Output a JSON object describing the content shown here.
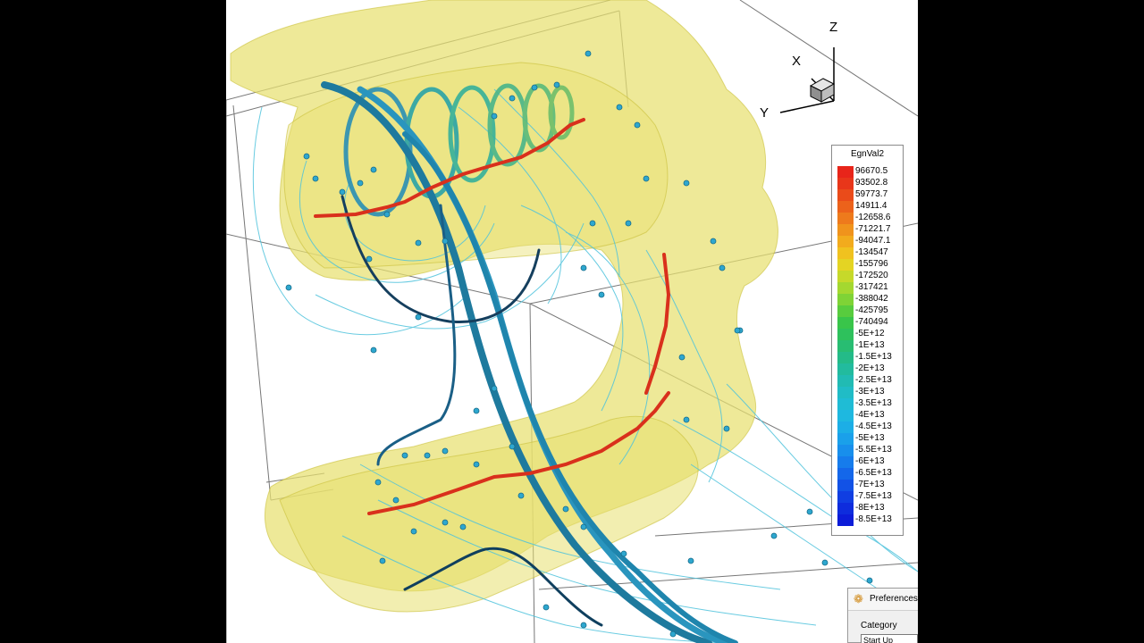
{
  "axes": {
    "x_label": "X",
    "y_label": "Y",
    "z_label": "Z"
  },
  "legend": {
    "title": "EgnVal2",
    "entries": [
      {
        "label": "96670.5",
        "color": "#e8251a"
      },
      {
        "label": "93502.8",
        "color": "#e8361a"
      },
      {
        "label": "59773.7",
        "color": "#ea4b1a"
      },
      {
        "label": "14911.4",
        "color": "#ec621b"
      },
      {
        "label": "-12658.6",
        "color": "#ee7a1c"
      },
      {
        "label": "-71221.7",
        "color": "#f0931c"
      },
      {
        "label": "-94047.1",
        "color": "#f2ab1d"
      },
      {
        "label": "-134547",
        "color": "#f0c21f"
      },
      {
        "label": "-155796",
        "color": "#e4d423"
      },
      {
        "label": "-172520",
        "color": "#c6d92a"
      },
      {
        "label": "-317421",
        "color": "#a4d830"
      },
      {
        "label": "-388042",
        "color": "#7fd336"
      },
      {
        "label": "-425795",
        "color": "#58cc3e"
      },
      {
        "label": "-740494",
        "color": "#39c54a"
      },
      {
        "label": "-5E+12",
        "color": "#2ec15c"
      },
      {
        "label": "-1E+13",
        "color": "#28bd72"
      },
      {
        "label": "-1.5E+13",
        "color": "#24bb88"
      },
      {
        "label": "-2E+13",
        "color": "#22bb9e"
      },
      {
        "label": "-2.5E+13",
        "color": "#21bbb3"
      },
      {
        "label": "-3E+13",
        "color": "#20bcc6"
      },
      {
        "label": "-3.5E+13",
        "color": "#1fbcd5"
      },
      {
        "label": "-4E+13",
        "color": "#1eb8e0"
      },
      {
        "label": "-4.5E+13",
        "color": "#1caee6"
      },
      {
        "label": "-5E+13",
        "color": "#1aa0ea"
      },
      {
        "label": "-5.5E+13",
        "color": "#188fec"
      },
      {
        "label": "-6E+13",
        "color": "#167cec"
      },
      {
        "label": "-6.5E+13",
        "color": "#1467ea"
      },
      {
        "label": "-7E+13",
        "color": "#1252e6"
      },
      {
        "label": "-7.5E+13",
        "color": "#103ee2"
      },
      {
        "label": "-8E+13",
        "color": "#0e2cdd"
      },
      {
        "label": "-8.5E+13",
        "color": "#0c1cd8"
      }
    ]
  },
  "preferences_dialog": {
    "title": "Preferences",
    "category_label": "Category",
    "category_value": "Start Up",
    "icon": "gear-flower-icon"
  },
  "colors": {
    "isosurface": "#e8e070",
    "streamline_thin": "#4fc3dc",
    "streamline_thick": "#2a8fb5",
    "vortex_core": "#d9301c"
  }
}
